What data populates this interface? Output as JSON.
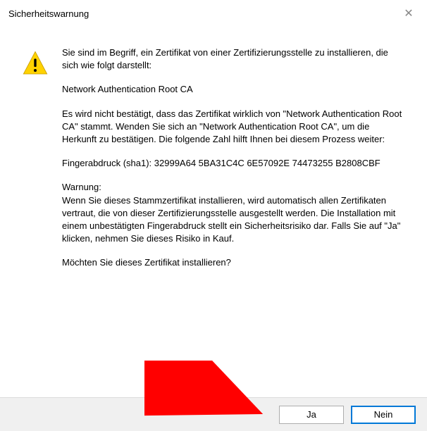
{
  "title": "Sicherheitswarnung",
  "body": {
    "intro": "Sie sind im Begriff, ein Zertifikat von einer Zertifizierungsstelle zu installieren, die sich wie folgt darstellt:",
    "ca_name": "Network Authentication Root CA",
    "not_verified": "Es wird nicht bestätigt, dass das Zertifikat wirklich von \"Network Authentication Root CA\" stammt. Wenden Sie sich an \"Network Authentication Root CA\", um die Herkunft zu bestätigen. Die folgende Zahl hilft Ihnen bei diesem Prozess weiter:",
    "fingerprint": "Fingerabdruck (sha1): 32999A64 5BA31C4C 6E57092E 74473255 B2808CBF",
    "warning_label": "Warnung:",
    "warning_text": "Wenn Sie dieses Stammzertifikat installieren, wird automatisch allen Zertifikaten vertraut, die von dieser Zertifizierungsstelle ausgestellt werden. Die Installation mit einem unbestätigten Fingerabdruck stellt ein Sicherheitsrisiko dar. Falls Sie auf \"Ja\" klicken, nehmen Sie dieses Risiko in Kauf.",
    "question": "Möchten Sie dieses Zertifikat installieren?"
  },
  "buttons": {
    "yes": "Ja",
    "no": "Nein"
  }
}
